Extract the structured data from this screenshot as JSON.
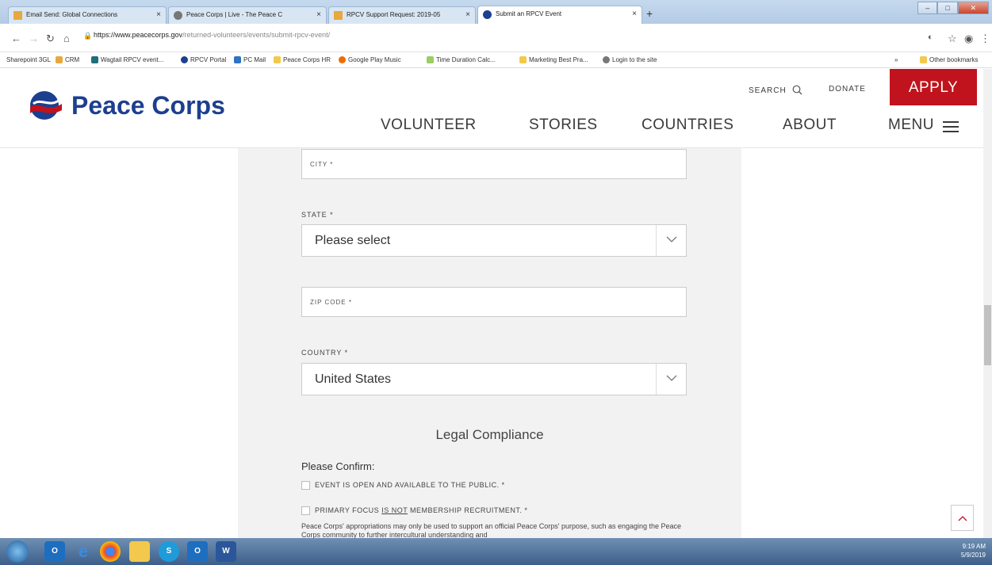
{
  "browser": {
    "tabs": [
      {
        "title": "Email Send: Global Connections",
        "close": "×",
        "color": "#e8a83c"
      },
      {
        "title": "Peace Corps | Live - The Peace C",
        "close": "×",
        "color": "#777777"
      },
      {
        "title": "RPCV Support Request: 2019-05",
        "close": "×",
        "color": "#e8a83c"
      },
      {
        "title": "Submit an RPCV Event",
        "close": "×",
        "color": "#1d3f8f"
      }
    ],
    "new_tab": "+",
    "url_host": "https://www.peacecorps.gov",
    "url_path": "/returned-volunteers/events/submit-rpcv-event/",
    "bookmarks": [
      "Sharepoint 3GL",
      "CRM",
      "Wagtail RPCV event...",
      "RPCV Portal",
      "PC Mail",
      "Peace Corps HR",
      "Google Play Music",
      "Time Duration Calc...",
      "Marketing Best Pra...",
      "Login to the site"
    ],
    "bookmark_overflow": "»",
    "other_bookmarks": "Other bookmarks"
  },
  "site": {
    "brand": "Peace Corps",
    "search_label": "SEARCH",
    "donate_label": "DONATE",
    "apply_label": "APPLY",
    "nav": [
      "VOLUNTEER",
      "STORIES",
      "COUNTRIES",
      "ABOUT"
    ],
    "menu_label": "MENU",
    "accent": "#c0131d",
    "brand_color": "#1d3f8f"
  },
  "form": {
    "city_placeholder": "CITY *",
    "state_label": "STATE *",
    "state_value": "Please select",
    "zip_placeholder": "ZIP CODE *",
    "country_label": "COUNTRY *",
    "country_value": "United States",
    "legal_title": "Legal Compliance",
    "please_confirm": "Please Confirm:",
    "check1": "EVENT IS OPEN AND AVAILABLE TO THE PUBLIC. *",
    "check2_pre": "PRIMARY FOCUS ",
    "check2_emph": "IS NOT",
    "check2_post": " MEMBERSHIP RECRUITMENT. *",
    "appropriations": "Peace Corps' appropriations may only be used to support an official Peace Corps' purpose, such as engaging the Peace Corps community to further intercultural understanding and"
  },
  "taskbar": {
    "time": "9:19 AM",
    "date": "5/9/2019"
  }
}
